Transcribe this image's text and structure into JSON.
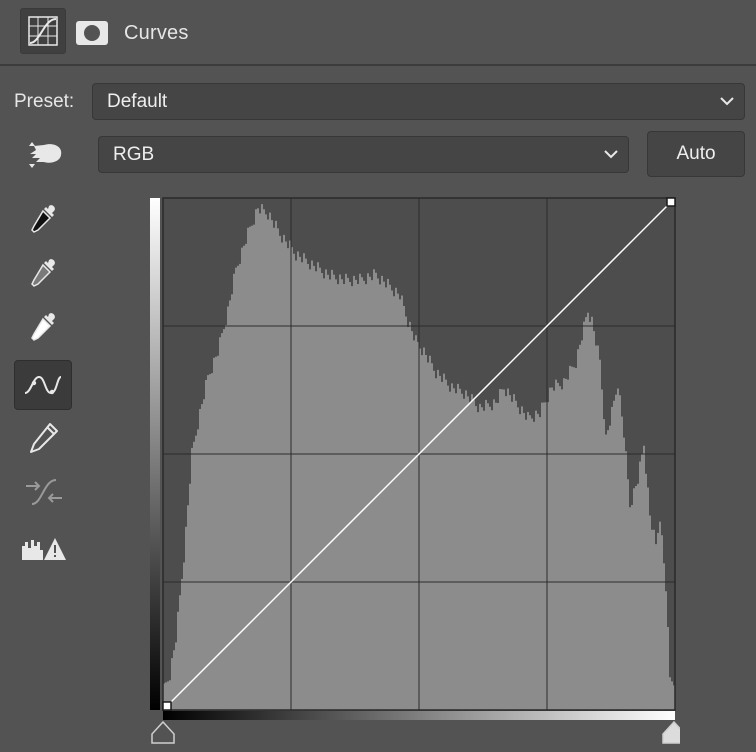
{
  "header": {
    "title": "Curves",
    "adjustment_icon": "curves-adjustment-icon",
    "mask_icon": "layer-mask-icon"
  },
  "preset": {
    "label": "Preset:",
    "value": "Default"
  },
  "channel": {
    "value": "RGB"
  },
  "auto_label": "Auto",
  "tools": [
    {
      "name": "on-image-adjustment-icon",
      "active": false
    },
    {
      "name": "black-point-eyedropper-icon",
      "active": false
    },
    {
      "name": "gray-point-eyedropper-icon",
      "active": false
    },
    {
      "name": "white-point-eyedropper-icon",
      "active": false
    },
    {
      "name": "curve-points-icon",
      "active": true
    },
    {
      "name": "pencil-icon",
      "active": false
    },
    {
      "name": "smooth-curve-icon",
      "active": false,
      "disabled": true
    },
    {
      "name": "clipping-warning-icon",
      "active": false
    }
  ],
  "curve": {
    "points": [
      [
        0,
        0
      ],
      [
        255,
        255
      ]
    ],
    "grid_divisions": 4
  },
  "colors": {
    "panel_bg": "#535353",
    "graph_bg": "#4d4d4d",
    "histogram": "#8c8c8c",
    "curve_line": "#ffffff"
  }
}
